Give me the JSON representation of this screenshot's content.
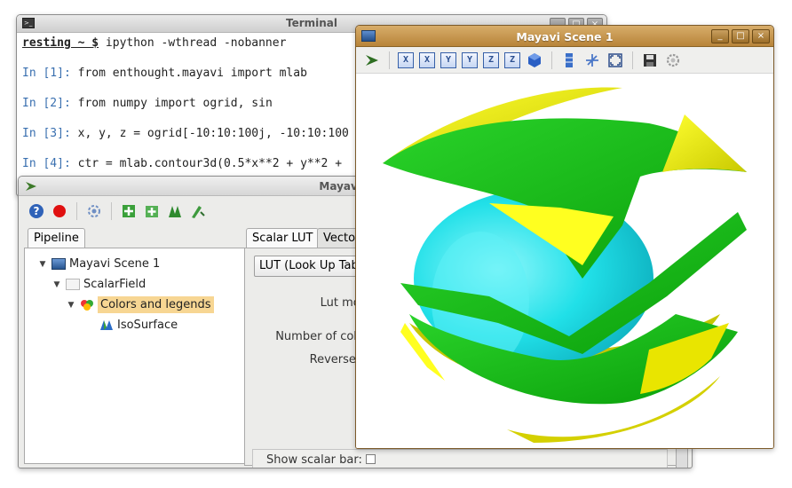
{
  "terminal": {
    "title": "Terminal",
    "prompt_user": "resting ~ $",
    "first_command": " ipython -wthread -nobanner",
    "lines": [
      {
        "prompt": "In [1]:",
        "code": " from enthought.mayavi import mlab"
      },
      {
        "prompt": "In [2]:",
        "code": " from numpy import ogrid, sin"
      },
      {
        "prompt": "In [3]:",
        "code": " x, y, z = ogrid[-10:10:100j, -10:10:100"
      },
      {
        "prompt": "In [4]:",
        "code": " ctr = mlab.contour3d(0.5*x**2 + y**2 +"
      }
    ]
  },
  "pipeline": {
    "title": "Mayavi pipe",
    "tab_label": "Pipeline",
    "tree": {
      "scene": "Mayavi Scene 1",
      "source": "ScalarField",
      "module_manager": "Colors and legends",
      "module": "IsoSurface"
    },
    "right_tabs": [
      "Scalar LUT",
      "Vecto"
    ],
    "lut_combo": "LUT (Look Up Tab",
    "fields": {
      "lut_mode": "Lut mode",
      "number_of_colors": "Number of colors",
      "reverse_lut": "Reverse lut"
    },
    "show_scalar_bar_label": "Show scalar bar:"
  },
  "scene": {
    "title": "Mayavi Scene 1",
    "view_buttons": [
      "X",
      "X",
      "Y",
      "Y",
      "Z",
      "Z"
    ]
  },
  "colors": {
    "isosurface_green": "#13c813",
    "isosurface_yellow": "#ffff00",
    "isosurface_cyan": "#21e0e8",
    "scene_title_bar": "#c39449",
    "selection": "#f7d693"
  },
  "window_buttons": {
    "minimize": "_",
    "maximize": "□",
    "close": "×"
  }
}
